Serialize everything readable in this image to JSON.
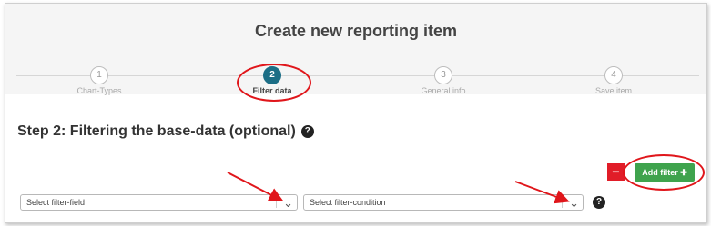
{
  "title": "Create new reporting item",
  "steps": [
    {
      "number": "1",
      "label": "Chart-Types",
      "active": false
    },
    {
      "number": "2",
      "label": "Filter data",
      "active": true
    },
    {
      "number": "3",
      "label": "General info",
      "active": false
    },
    {
      "number": "4",
      "label": "Save item",
      "active": false
    }
  ],
  "heading": "Step 2: Filtering the base-data (optional)",
  "help_glyph": "?",
  "remove_filter_glyph": "−",
  "add_filter_label": "Add filter ✚",
  "filter_field": {
    "value": "Select filter-field"
  },
  "filter_condition": {
    "value": "Select filter-condition"
  },
  "colors": {
    "accent": "#1c6e86",
    "add": "#3fa34d",
    "remove": "#e11d28",
    "annotation": "#e0161b"
  }
}
